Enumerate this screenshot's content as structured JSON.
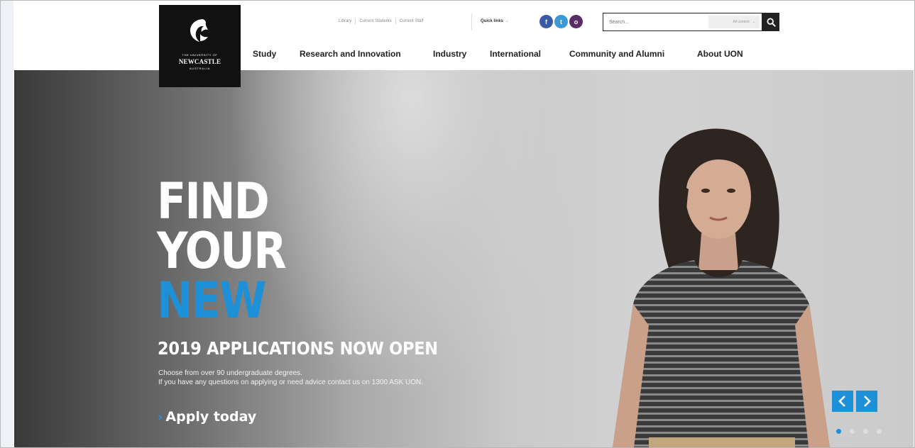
{
  "brand": {
    "line1": "THE UNIVERSITY OF",
    "line2": "NEWCASTLE",
    "line3": "AUSTRALIA"
  },
  "utility_links": [
    "Library",
    "Current Students",
    "Current Staff"
  ],
  "quick_links_label": "Quick links",
  "social": {
    "facebook": "f",
    "twitter": "t",
    "instagram": "o"
  },
  "search": {
    "placeholder": "Search...",
    "scope": "All content"
  },
  "nav": [
    "Study",
    "Research and Innovation",
    "Industry",
    "International",
    "Community and Alumni",
    "About UON"
  ],
  "hero": {
    "headline": [
      "FIND",
      "YOUR",
      "NEW"
    ],
    "subhead": "2019 APPLICATIONS NOW OPEN",
    "description": [
      "Choose from over 90 undergraduate degrees.",
      "If you have any questions on applying or need advice contact us on 1300 ASK UON."
    ],
    "cta": "Apply today"
  },
  "carousel": {
    "slides": 4,
    "active_index": 0
  },
  "colors": {
    "accent": "#1e90d8",
    "logo_bg": "#111111",
    "facebook": "#3b5aa5",
    "twitter": "#3a9ad9",
    "instagram": "#5a2b66"
  }
}
